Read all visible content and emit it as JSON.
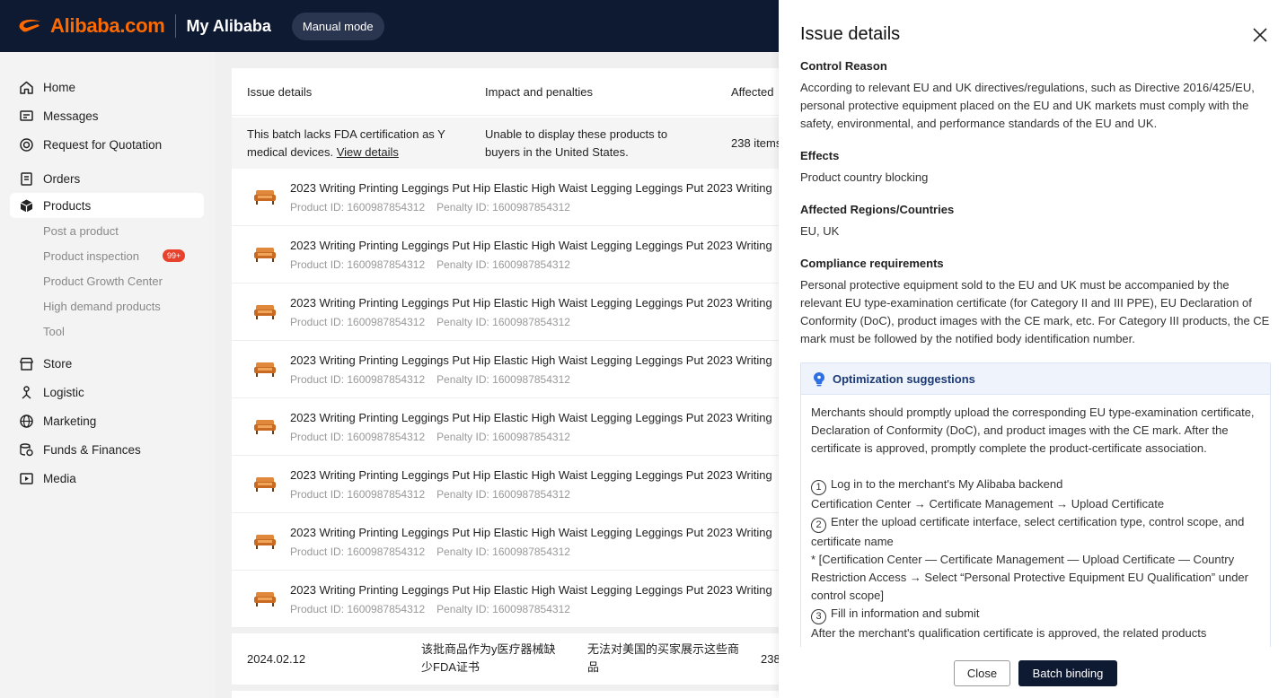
{
  "header": {
    "logo_text": "Alibaba.com",
    "title": "My Alibaba",
    "mode_label": "Manual mode",
    "brand_color": "#ff6a00",
    "bar_color": "#0e1932"
  },
  "sidebar": {
    "items": [
      {
        "label": "Home",
        "icon": "home-icon"
      },
      {
        "label": "Messages",
        "icon": "message-icon"
      },
      {
        "label": "Request for Quotation",
        "icon": "rfq-icon"
      },
      {
        "label": "Orders",
        "icon": "orders-icon"
      },
      {
        "label": "Products",
        "icon": "box-icon",
        "active": true
      },
      {
        "label": "Store",
        "icon": "store-icon"
      },
      {
        "label": "Logistic",
        "icon": "logistic-icon"
      },
      {
        "label": "Marketing",
        "icon": "globe-icon"
      },
      {
        "label": "Funds & Finances",
        "icon": "coins-icon"
      },
      {
        "label": "Media",
        "icon": "media-icon"
      }
    ],
    "product_sub": [
      {
        "label": "Post a product"
      },
      {
        "label": "Product inspection",
        "badge": "99+"
      },
      {
        "label": "Product Growth Center"
      },
      {
        "label": "High demand products"
      },
      {
        "label": "Tool"
      }
    ]
  },
  "table": {
    "headers": [
      "Issue details",
      "Impact and penalties",
      "Affected"
    ],
    "issue": {
      "text": "This batch lacks FDA certification as Y medical devices.",
      "link": "View details",
      "impact": "Unable to display these products to buyers in the United States.",
      "affected": "238 items"
    },
    "products": [
      {
        "title": "2023 Writing Printing Leggings Put Hip Elastic High Waist Legging Leggings Put 2023 Writing",
        "product_id": "Product ID: 1600987854312",
        "penalty_id": "Penalty ID: 1600987854312"
      },
      {
        "title": "2023 Writing Printing Leggings Put Hip Elastic High Waist Legging Leggings Put 2023 Writing",
        "product_id": "Product ID: 1600987854312",
        "penalty_id": "Penalty ID: 1600987854312"
      },
      {
        "title": "2023 Writing Printing Leggings Put Hip Elastic High Waist Legging Leggings Put 2023 Writing",
        "product_id": "Product ID: 1600987854312",
        "penalty_id": "Penalty ID: 1600987854312"
      },
      {
        "title": "2023 Writing Printing Leggings Put Hip Elastic High Waist Legging Leggings Put 2023 Writing",
        "product_id": "Product ID: 1600987854312",
        "penalty_id": "Penalty ID: 1600987854312"
      },
      {
        "title": "2023 Writing Printing Leggings Put Hip Elastic High Waist Legging Leggings Put 2023 Writing",
        "product_id": "Product ID: 1600987854312",
        "penalty_id": "Penalty ID: 1600987854312"
      },
      {
        "title": "2023 Writing Printing Leggings Put Hip Elastic High Waist Legging Leggings Put 2023 Writing",
        "product_id": "Product ID: 1600987854312",
        "penalty_id": "Penalty ID: 1600987854312"
      },
      {
        "title": "2023 Writing Printing Leggings Put Hip Elastic High Waist Legging Leggings Put 2023 Writing",
        "product_id": "Product ID: 1600987854312",
        "penalty_id": "Penalty ID: 1600987854312"
      },
      {
        "title": "2023 Writing Printing Leggings Put Hip Elastic High Waist Legging Leggings Put 2023 Writing",
        "product_id": "Product ID: 1600987854312",
        "penalty_id": "Penalty ID: 1600987854312"
      }
    ],
    "row2": {
      "date": "2024.02.12",
      "issue": "该批商品作为y医疗器械缺少FDA证书",
      "impact": "无法对美国的买家展示这些商品",
      "affected": "238"
    }
  },
  "drawer": {
    "title": "Issue details",
    "control_reason_label": "Control Reason",
    "control_reason": "According to relevant EU and UK directives/regulations, such as Directive 2016/425/EU, personal protective equipment placed on the EU and UK markets must comply with the safety, environmental, and performance standards of the EU and UK.",
    "effects_label": "Effects",
    "effects": "Product country blocking",
    "regions_label": "Affected Regions/Countries",
    "regions": "EU, UK",
    "compliance_label": "Compliance requirements",
    "compliance": "Personal protective equipment sold to the EU and UK must be accompanied by the relevant EU type-examination certificate (for Category II and III PPE), EU Declaration of Conformity (DoC), product images with the CE mark, etc. For Category III products, the CE mark must be followed by the notified body identification number.",
    "optimization": {
      "title": "Optimization suggestions",
      "intro": "Merchants should promptly upload the corresponding EU type-examination certificate, Declaration of Conformity (DoC), and product images with the CE mark. After the certificate is approved, promptly complete the product-certificate association.",
      "step1_num": "1",
      "step1": "Log in to the merchant's My Alibaba backend",
      "step1_path": "Certification Center → Certificate Management → Upload Certificate",
      "step2_num": "2",
      "step2": "Enter the upload certificate interface, select certification type, control scope, and certificate name",
      "step2_note": "* [Certification Center — Certificate Management — Upload Certificate — Country Restriction Access → Select “Personal Protective Equipment EU Qualification” under control scope]",
      "step3_num": "3",
      "step3": "Fill in information and submit",
      "step3_after": "After the merchant's qualification certificate is approved, the related products"
    },
    "close_label": "Close",
    "batch_label": "Batch binding"
  }
}
